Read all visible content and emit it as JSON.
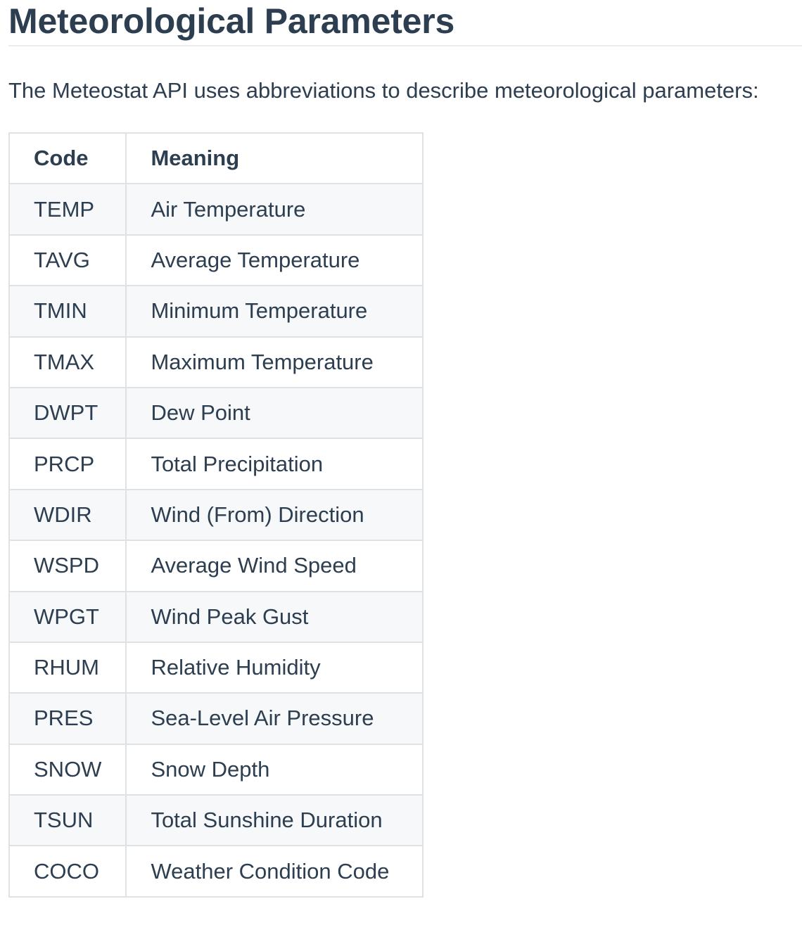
{
  "heading": "Meteorological Parameters",
  "intro": "The Meteostat API uses abbreviations to describe meteorological parameters:",
  "table": {
    "headers": [
      "Code",
      "Meaning"
    ],
    "rows": [
      {
        "code": "TEMP",
        "meaning": "Air Temperature"
      },
      {
        "code": "TAVG",
        "meaning": "Average Temperature"
      },
      {
        "code": "TMIN",
        "meaning": "Minimum Temperature"
      },
      {
        "code": "TMAX",
        "meaning": "Maximum Temperature"
      },
      {
        "code": "DWPT",
        "meaning": "Dew Point"
      },
      {
        "code": "PRCP",
        "meaning": "Total Precipitation"
      },
      {
        "code": "WDIR",
        "meaning": "Wind (From) Direction"
      },
      {
        "code": "WSPD",
        "meaning": "Average Wind Speed"
      },
      {
        "code": "WPGT",
        "meaning": "Wind Peak Gust"
      },
      {
        "code": "RHUM",
        "meaning": "Relative Humidity"
      },
      {
        "code": "PRES",
        "meaning": "Sea-Level Air Pressure"
      },
      {
        "code": "SNOW",
        "meaning": "Snow Depth"
      },
      {
        "code": "TSUN",
        "meaning": "Total Sunshine Duration"
      },
      {
        "code": "COCO",
        "meaning": "Weather Condition Code"
      }
    ]
  }
}
